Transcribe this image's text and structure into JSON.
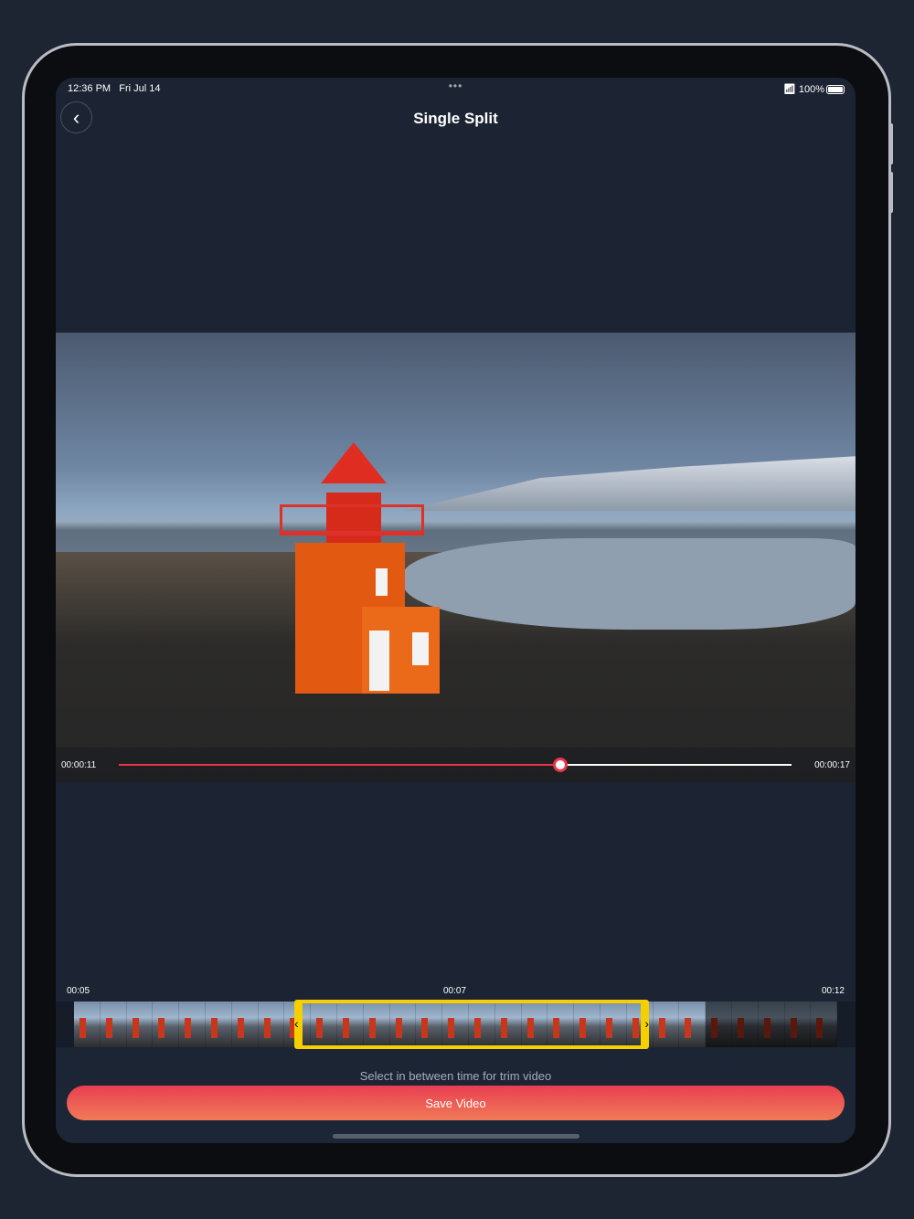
{
  "status_bar": {
    "time": "12:36 PM",
    "date": "Fri Jul 14",
    "battery": "100%",
    "wifi_icon": "wifi-icon",
    "battery_icon": "battery-icon"
  },
  "header": {
    "title": "Single Split",
    "back_icon": "chevron-left-icon"
  },
  "player": {
    "current_time": "00:00:11",
    "total_time": "00:00:17",
    "progress": 0.656,
    "accent": "#ea3349"
  },
  "trimmer": {
    "start_label": "00:05",
    "mid_label": "00:07",
    "end_label": "00:12",
    "selection_color": "#f5cf00",
    "thumbnail_count": 29,
    "selection_start_index": 9,
    "selection_end_index": 22
  },
  "hint": "Select in between time for trim video",
  "save_button": "Save Video"
}
